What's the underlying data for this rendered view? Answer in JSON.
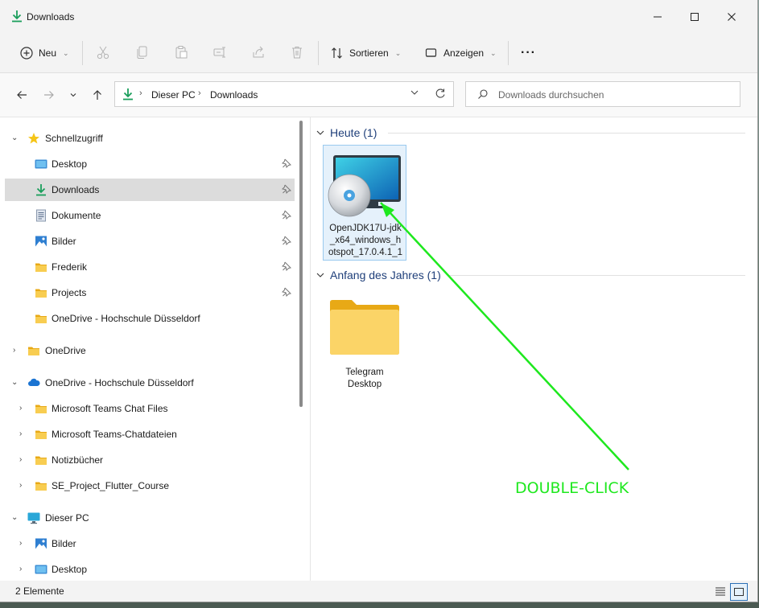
{
  "window": {
    "title": "Downloads"
  },
  "toolbar": {
    "new_label": "Neu",
    "sort_label": "Sortieren",
    "view_label": "Anzeigen",
    "more_label": "···"
  },
  "address": {
    "crumbs": [
      "Dieser PC",
      "Downloads"
    ],
    "search_placeholder": "Downloads durchsuchen"
  },
  "nav": {
    "quick_access": "Schnellzugriff",
    "items": [
      {
        "label": "Desktop",
        "icon": "desktop-icon",
        "pinned": true
      },
      {
        "label": "Downloads",
        "icon": "download-icon",
        "pinned": true,
        "selected": true
      },
      {
        "label": "Dokumente",
        "icon": "document-icon",
        "pinned": true
      },
      {
        "label": "Bilder",
        "icon": "pictures-icon",
        "pinned": true
      },
      {
        "label": "Frederik",
        "icon": "folder-icon",
        "pinned": true
      },
      {
        "label": "Projects",
        "icon": "folder-icon",
        "pinned": true
      },
      {
        "label": "OneDrive - Hochschule Düsseldorf",
        "icon": "folder-icon",
        "pinned": false
      }
    ],
    "onedrive": "OneDrive",
    "onedrive_hs": "OneDrive - Hochschule Düsseldorf",
    "onedrive_children": [
      "Microsoft Teams Chat Files",
      "Microsoft Teams-Chatdateien",
      "Notizbücher",
      "SE_Project_Flutter_Course"
    ],
    "this_pc": "Dieser PC",
    "pc_children": [
      "Bilder",
      "Desktop"
    ]
  },
  "content": {
    "group_today": "Heute (1)",
    "group_year": "Anfang des Jahres (1)",
    "file_installer": "OpenJDK17U-jdk_x64_windows_hotspot_17.0.4.1_1",
    "file_installer_lines": [
      "OpenJDK17U-jdk",
      "_x64_windows_h",
      "otspot_17.0.4.1_1"
    ],
    "folder_telegram_lines": [
      "Telegram",
      "Desktop"
    ]
  },
  "status": {
    "count": "2 Elemente"
  },
  "annotation": {
    "text": "DOUBLE-CLICK",
    "color": "#1ee81e"
  },
  "colors": {
    "accent_green": "#1a9e5b",
    "folder_yellow": "#f5c542",
    "selection": "#e5f1fb"
  }
}
